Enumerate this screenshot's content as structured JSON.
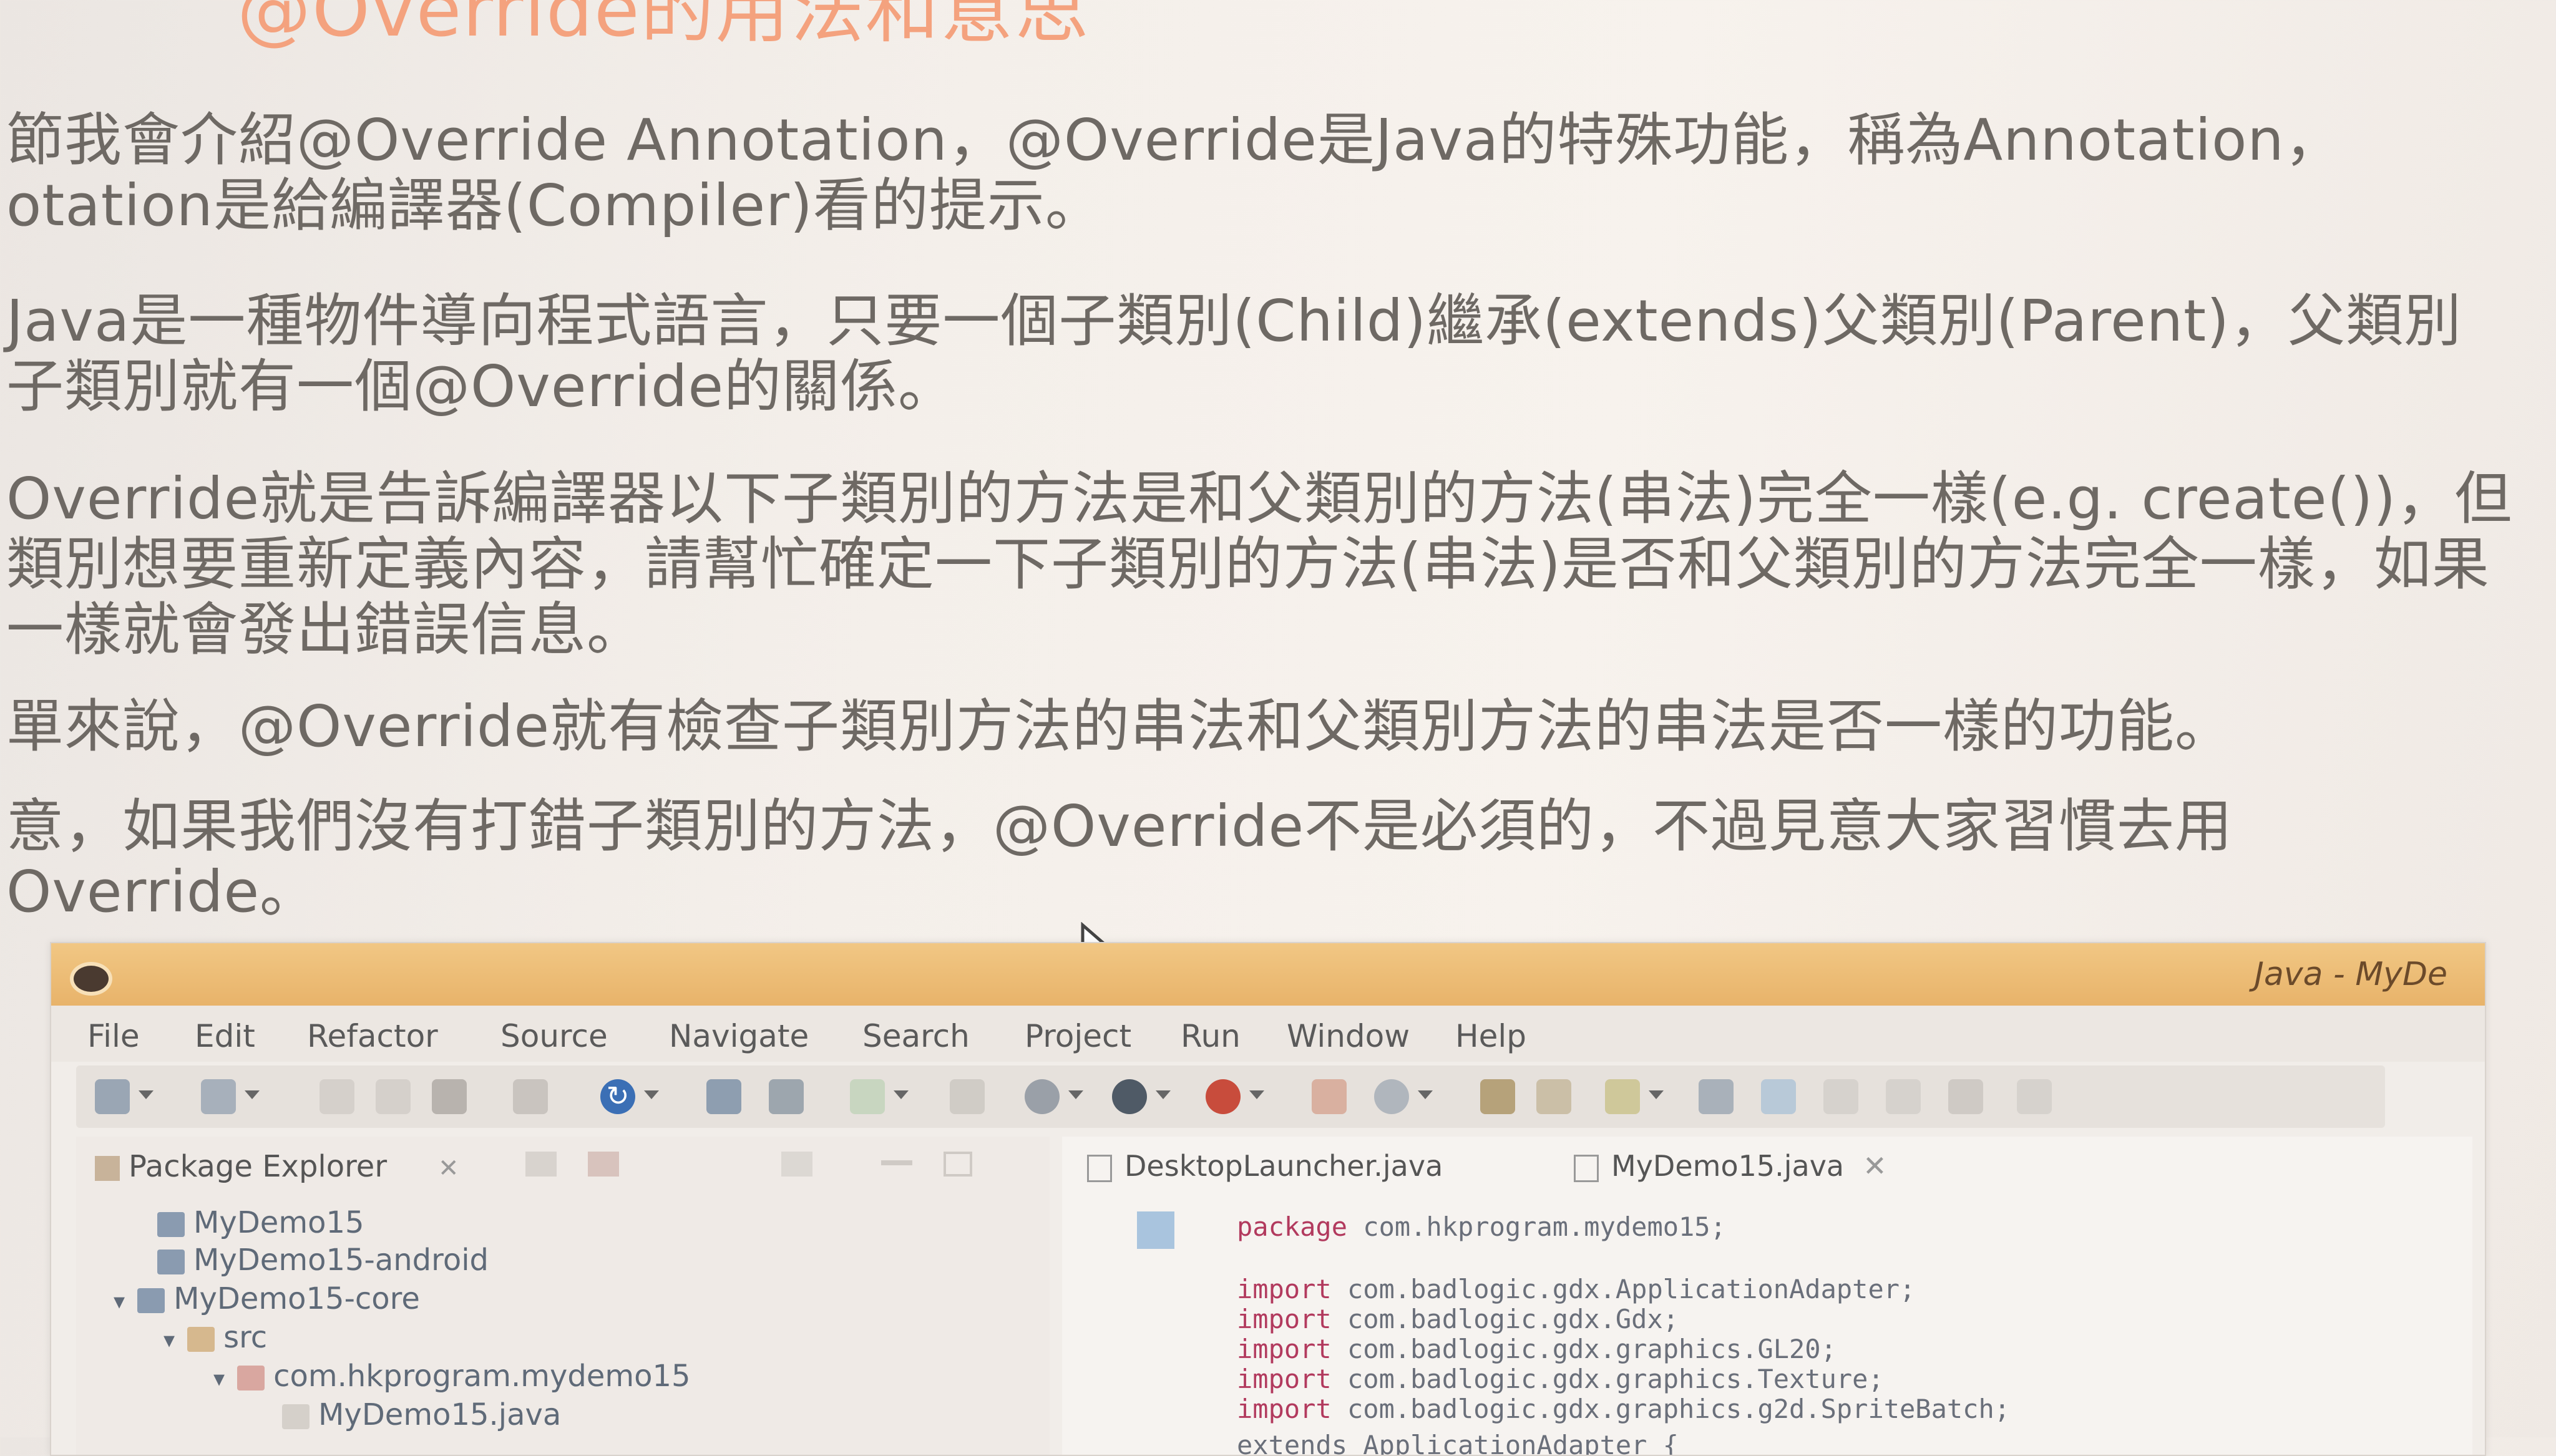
{
  "article": {
    "title": "@Override的用法和意思",
    "lines": [
      "節我會介紹@Override Annotation，@Override是Java的特殊功能，稱為Annotation，",
      "otation是給編譯器(Compiler)看的提示。",
      "Java是一種物件導向程式語言，只要一個子類別(Child)繼承(extends)父類別(Parent)，父類別",
      "子類別就有一個@Override的關係。",
      "Override就是告訴編譯器以下子類別的方法是和父類別的方法(串法)完全一樣(e.g. create())，但",
      "類別想要重新定義內容，請幫忙確定一下子類別的方法(串法)是否和父類別的方法完全一樣，如果",
      "一樣就會發出錯誤信息。",
      "單來說，@Override就有檢查子類別方法的串法和父類別方法的串法是否一樣的功能。",
      "意，如果我們沒有打錯子類別的方法，@Override不是必須的，不過見意大家習慣去用",
      "Override。"
    ]
  },
  "ide": {
    "window_title": "Java - MyDe",
    "menu": [
      "File",
      "Edit",
      "Refactor",
      "Source",
      "Navigate",
      "Search",
      "Project",
      "Run",
      "Window",
      "Help"
    ],
    "package_explorer": {
      "title": "Package Explorer",
      "items": [
        {
          "label": "MyDemo15"
        },
        {
          "label": "MyDemo15-android"
        },
        {
          "label": "MyDemo15-core"
        },
        {
          "label": "src"
        },
        {
          "label": "com.hkprogram.mydemo15"
        },
        {
          "label": "MyDemo15.java"
        }
      ]
    },
    "editor": {
      "tabs": [
        "DesktopLauncher.java",
        "MyDemo15.java"
      ],
      "code": [
        {
          "kw": "package",
          "rest": " com.hkprogram.mydemo15;"
        },
        {
          "kw": "import",
          "rest": " com.badlogic.gdx.ApplicationAdapter;"
        },
        {
          "kw": "import",
          "rest": " com.badlogic.gdx.Gdx;"
        },
        {
          "kw": "import",
          "rest": " com.badlogic.gdx.graphics.GL20;"
        },
        {
          "kw": "import",
          "rest": " com.badlogic.gdx.graphics.Texture;"
        },
        {
          "kw": "import",
          "rest": " com.badlogic.gdx.graphics.g2d.SpriteBatch;"
        },
        {
          "kw": "",
          "rest": "                 extends ApplicationAdapter {"
        }
      ]
    }
  },
  "colors": {
    "title_orange": "#f4a27e",
    "titlebar": "#e8b36a",
    "keyword": "#b23a5e"
  }
}
